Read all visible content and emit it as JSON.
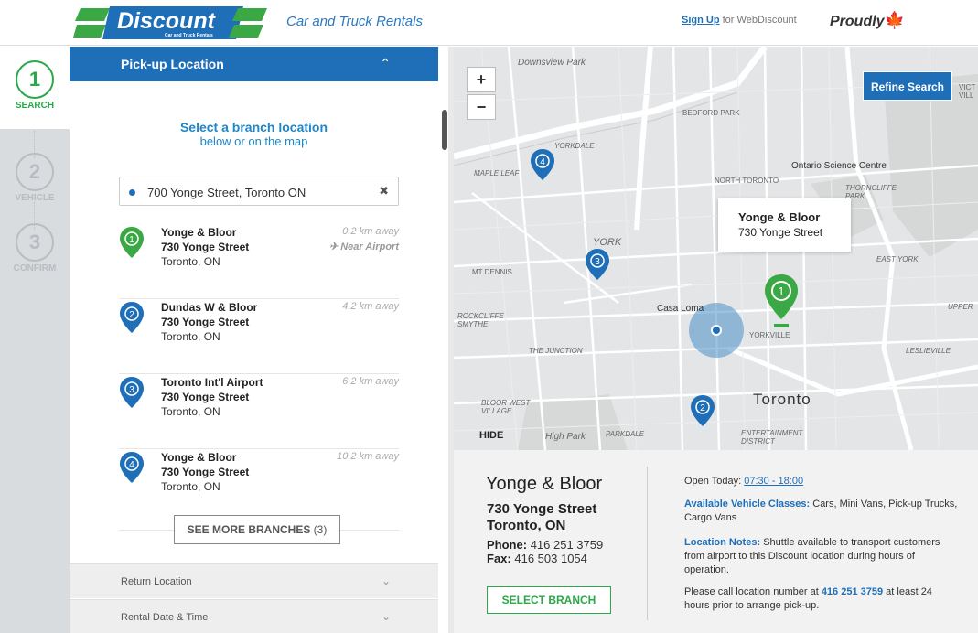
{
  "header": {
    "logo_text": "Discount",
    "logo_subtext": "Car and Truck Rentals",
    "tagline": "Car and Truck Rentals",
    "signup_link": "Sign Up",
    "signup_suffix": "for WebDiscount",
    "proudly": "Proudly"
  },
  "steps": [
    {
      "number": "1",
      "label": "SEARCH",
      "active": true
    },
    {
      "number": "2",
      "label": "VEHICLE",
      "active": false
    },
    {
      "number": "3",
      "label": "CONFIRM",
      "active": false
    }
  ],
  "pickup": {
    "heading": "Pick-up Location",
    "select_title": "Select a branch location",
    "select_sub": "below or on the map",
    "search_value": "700 Yonge Street, Toronto ON",
    "branches": [
      {
        "num": "1",
        "name": "Yonge & Bloor",
        "address": "730 Yonge Street",
        "city": "Toronto, ON",
        "distance": "0.2 km away",
        "note": "✈ Near Airport",
        "color": "#3aa844"
      },
      {
        "num": "2",
        "name": "Dundas W & Bloor",
        "address": "730 Yonge Street",
        "city": "Toronto, ON",
        "distance": "4.2 km away",
        "note": "",
        "color": "#1f6fb8"
      },
      {
        "num": "3",
        "name": "Toronto Int'l Airport",
        "address": "730 Yonge Street",
        "city": "Toronto, ON",
        "distance": "6.2 km away",
        "note": "",
        "color": "#1f6fb8"
      },
      {
        "num": "4",
        "name": "Yonge & Bloor",
        "address": "730 Yonge Street",
        "city": "Toronto, ON",
        "distance": "10.2 km away",
        "note": "",
        "color": "#1f6fb8"
      }
    ],
    "see_more_label": "SEE MORE BRANCHES",
    "see_more_count": "(3)"
  },
  "accordions": {
    "return_location": "Return Location",
    "rental_date_time": "Rental Date & Time"
  },
  "map": {
    "zoom_in": "+",
    "zoom_out": "−",
    "refine_button": "Refine Search",
    "hide_label": "HIDE",
    "popup": {
      "name": "Yonge & Bloor",
      "address": "730 Yonge Street"
    },
    "city_label": "Toronto",
    "labels": [
      "Downsview Park",
      "BEDFORD PARK",
      "YORKDALE",
      "MAPLE LEAF",
      "NORTH TORONTO",
      "Ontario Science Centre",
      "THORNCLIFFE PARK",
      "YORK",
      "MT DENNIS",
      "EAST YORK",
      "Casa Loma",
      "YORKVILLE",
      "ROCKCLIFFE SMYTHE",
      "THE JUNCTION",
      "LESLIEVILLE",
      "BLOOR WEST VILLAGE",
      "High Park",
      "PARKDALE",
      "ENTERTAINMENT DISTRICT",
      "VICT VILL",
      "UPPER"
    ]
  },
  "details": {
    "name": "Yonge & Bloor",
    "address": "730 Yonge Street",
    "city": "Toronto, ON",
    "phone_label": "Phone:",
    "phone": "416 251 3759",
    "fax_label": "Fax:",
    "fax": "416 503 1054",
    "select_button": "SELECT BRANCH",
    "open_label": "Open Today:",
    "open_hours": "07:30 - 18:00",
    "classes_label": "Available Vehicle Classes:",
    "classes": "Cars, Mini Vans, Pick-up Trucks, Cargo Vans",
    "notes_label": "Location Notes:",
    "notes": "Shuttle available to transport customers from airport to this Discount location during hours of operation.",
    "call_prefix": "Please call location number at",
    "call_number": "416 251 3759",
    "call_suffix": "at least 24 hours prior to arrange pick-up."
  },
  "colors": {
    "brand_blue": "#1f6fb8",
    "brand_green": "#2aa84a",
    "pin_green": "#3aa844"
  }
}
